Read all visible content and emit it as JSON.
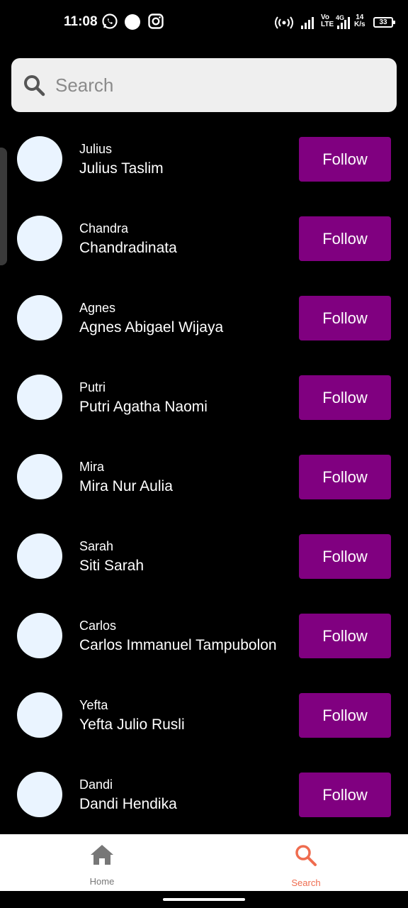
{
  "status_bar": {
    "time": "11:08",
    "volte_top": "Vo",
    "volte_bottom": "LTE",
    "network": "4G",
    "speed_top": "14",
    "speed_bottom": "K/s",
    "battery": "33"
  },
  "search": {
    "placeholder": "Search",
    "value": ""
  },
  "users": [
    {
      "username": "Julius",
      "full_name": "Julius Taslim",
      "button": "Follow"
    },
    {
      "username": "Chandra",
      "full_name": "Chandradinata",
      "button": "Follow"
    },
    {
      "username": "Agnes",
      "full_name": "Agnes Abigael Wijaya",
      "button": "Follow"
    },
    {
      "username": "Putri",
      "full_name": "Putri Agatha Naomi",
      "button": "Follow"
    },
    {
      "username": "Mira",
      "full_name": "Mira Nur Aulia",
      "button": "Follow"
    },
    {
      "username": "Sarah",
      "full_name": "Siti Sarah",
      "button": "Follow"
    },
    {
      "username": "Carlos",
      "full_name": "Carlos Immanuel Tampubolon",
      "button": "Follow"
    },
    {
      "username": "Yefta",
      "full_name": "Yefta Julio Rusli",
      "button": "Follow"
    },
    {
      "username": "Dandi",
      "full_name": "Dandi Hendika",
      "button": "Follow"
    }
  ],
  "bottom_nav": {
    "items": [
      {
        "label": "Home",
        "icon": "home-icon",
        "active": false
      },
      {
        "label": "Search",
        "icon": "search-icon",
        "active": true
      }
    ]
  },
  "colors": {
    "follow_button": "#800080",
    "active_nav": "#ef6c4f",
    "inactive_nav": "#777777",
    "avatar": "#eaf4ff"
  }
}
